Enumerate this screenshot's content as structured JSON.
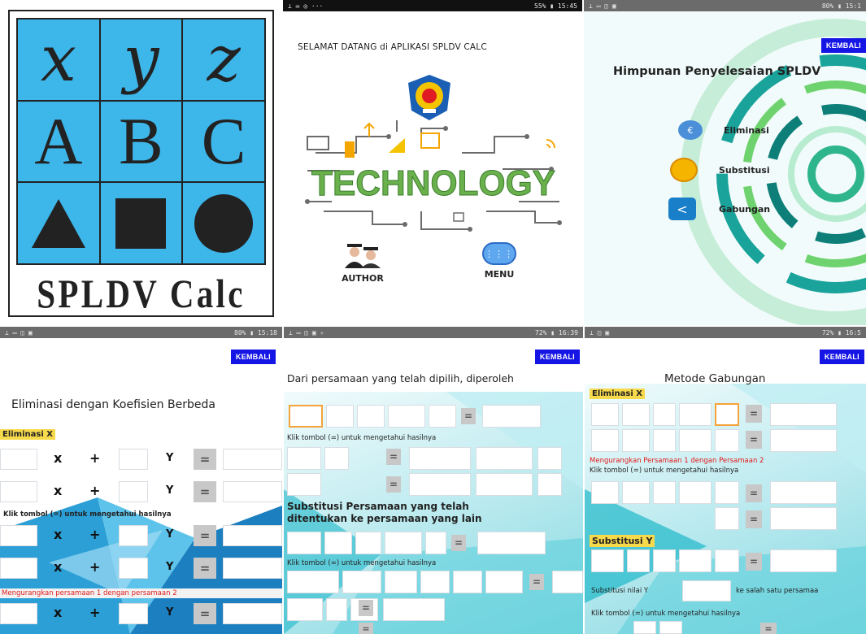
{
  "panel1": {
    "letters_row1": [
      "x",
      "y",
      "z"
    ],
    "letters_row2": [
      "A",
      "B",
      "C"
    ],
    "title": "SPLDV Calc",
    "grid_color": "#3db6ea"
  },
  "panel2": {
    "status_time": "15:45",
    "status_batt": "55%",
    "welcome": "SELAMAT DATANG di APLIKASI SPLDV CALC",
    "tech_word": "TECHNOLOGY",
    "author_label": "AUTHOR",
    "menu_label": "MENU"
  },
  "panel3": {
    "status_batt": "80%",
    "status_time": "15:1",
    "kembali": "KEMBALI",
    "title": "Himpunan Penyelesaian SPLDV",
    "items": [
      "Eliminasi",
      "Substitusi",
      "Gabungan"
    ]
  },
  "panel4": {
    "status_batt": "80%",
    "status_time": "15:18",
    "kembali": "KEMBALI",
    "title": "Eliminasi dengan Koefisien Berbeda",
    "section": "Eliminasi X",
    "x": "x",
    "plus": "+",
    "y": "Y",
    "equals": "=",
    "hint": "Klik tombol (=) untuk mengetahui hasilnya",
    "subtract": "Mengurangkan persamaan 1 dengan persamaan 2"
  },
  "panel5": {
    "status_batt": "72%",
    "status_time": "16:39",
    "kembali": "KEMBALI",
    "heading": "Dari persamaan yang telah dipilih, diperoleh",
    "hint1": "Klik tombol (=) untuk mengetahui hasilnya",
    "substitusi_heading_1": "Substitusi Persamaan yang telah",
    "substitusi_heading_2": "ditentukan ke persamaan yang lain",
    "hint2": "Klik tombol (=) untuk mengetahui hasilnya",
    "equals": "="
  },
  "panel6": {
    "status_batt": "72%",
    "status_time": "16:5",
    "kembali": "KEMBALI",
    "title": "Metode Gabungan",
    "section1": "Eliminasi X",
    "subtract": "Mengurangkan Persamaan 1 dengan Persamaan 2",
    "hint1": "Klik tombol (=) untuk mengetahui hasilnya",
    "section2": "Substitusi Y",
    "subst_label": "Substitusi nilai Y",
    "subst_suffix": "ke salah satu persamaa",
    "hint2": "Klik tombol (=) untuk mengetahui hasilnya",
    "equals": "="
  }
}
